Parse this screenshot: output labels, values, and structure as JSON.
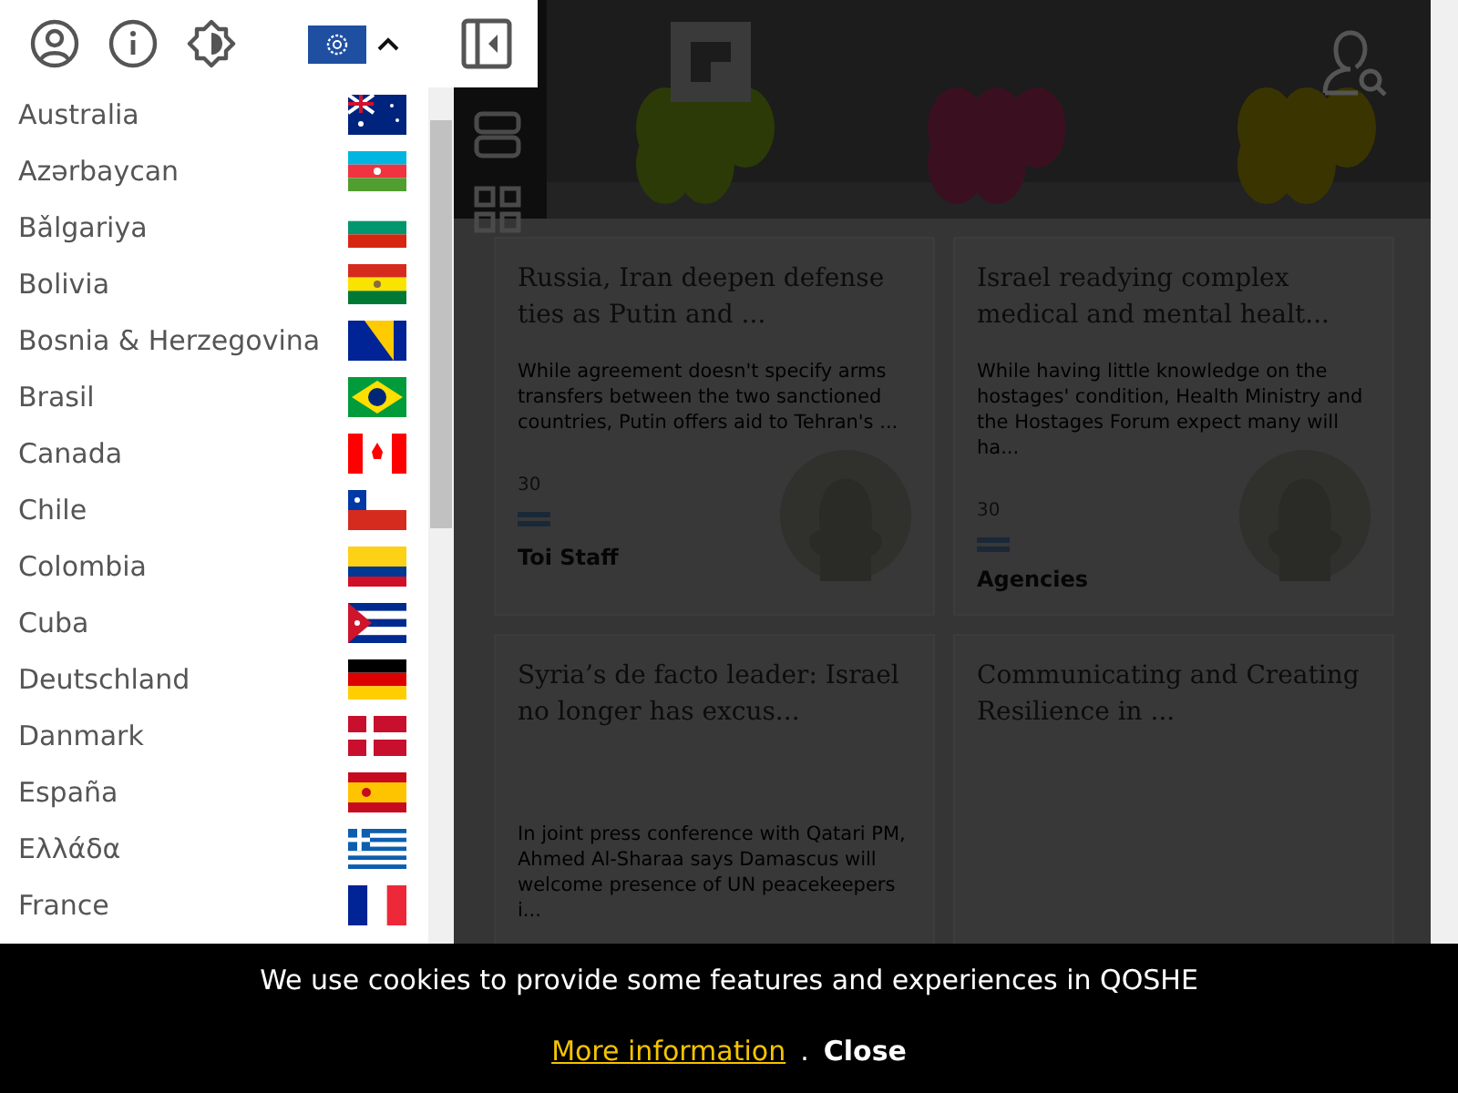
{
  "toolbar": {
    "language_menu_expanded": true
  },
  "languages": [
    "Australia",
    "Azərbaycan",
    "Bǎlgariya",
    "Bolivia",
    "Bosnia & Herzegovina",
    "Brasil",
    "Canada",
    "Chile",
    "Colombia",
    "Cuba",
    "Deutschland",
    "Danmark",
    "España",
    "Ελλάδα",
    "France"
  ],
  "articles": [
    {
      "title": "Russia, Iran deepen defense ties as Putin and ...",
      "excerpt": "While agreement doesn't specify arms transfers between the two sanctioned countries, Putin offers aid to Tehran's ...",
      "date": "30",
      "author": "Toi Staff"
    },
    {
      "title": "Israel readying complex medical and mental healt...",
      "excerpt": "While having little knowledge on the hostages' condition, Health Ministry and the Hostages Forum expect many will ha...",
      "date": "30",
      "author": "Agencies"
    },
    {
      "title": "Syria’s de facto leader: Israel no longer has excus...",
      "excerpt": "In joint press conference with Qatari PM, Ahmed Al-Sharaa says Damascus will welcome presence of UN peacekeepers i..."
    },
    {
      "title": "Communicating and Creating Resilience in ..."
    }
  ],
  "cookie_banner": {
    "message": "We use cookies to provide some features and experiences in QOSHE",
    "link": "More information",
    "separator": ".",
    "close": "Close"
  }
}
